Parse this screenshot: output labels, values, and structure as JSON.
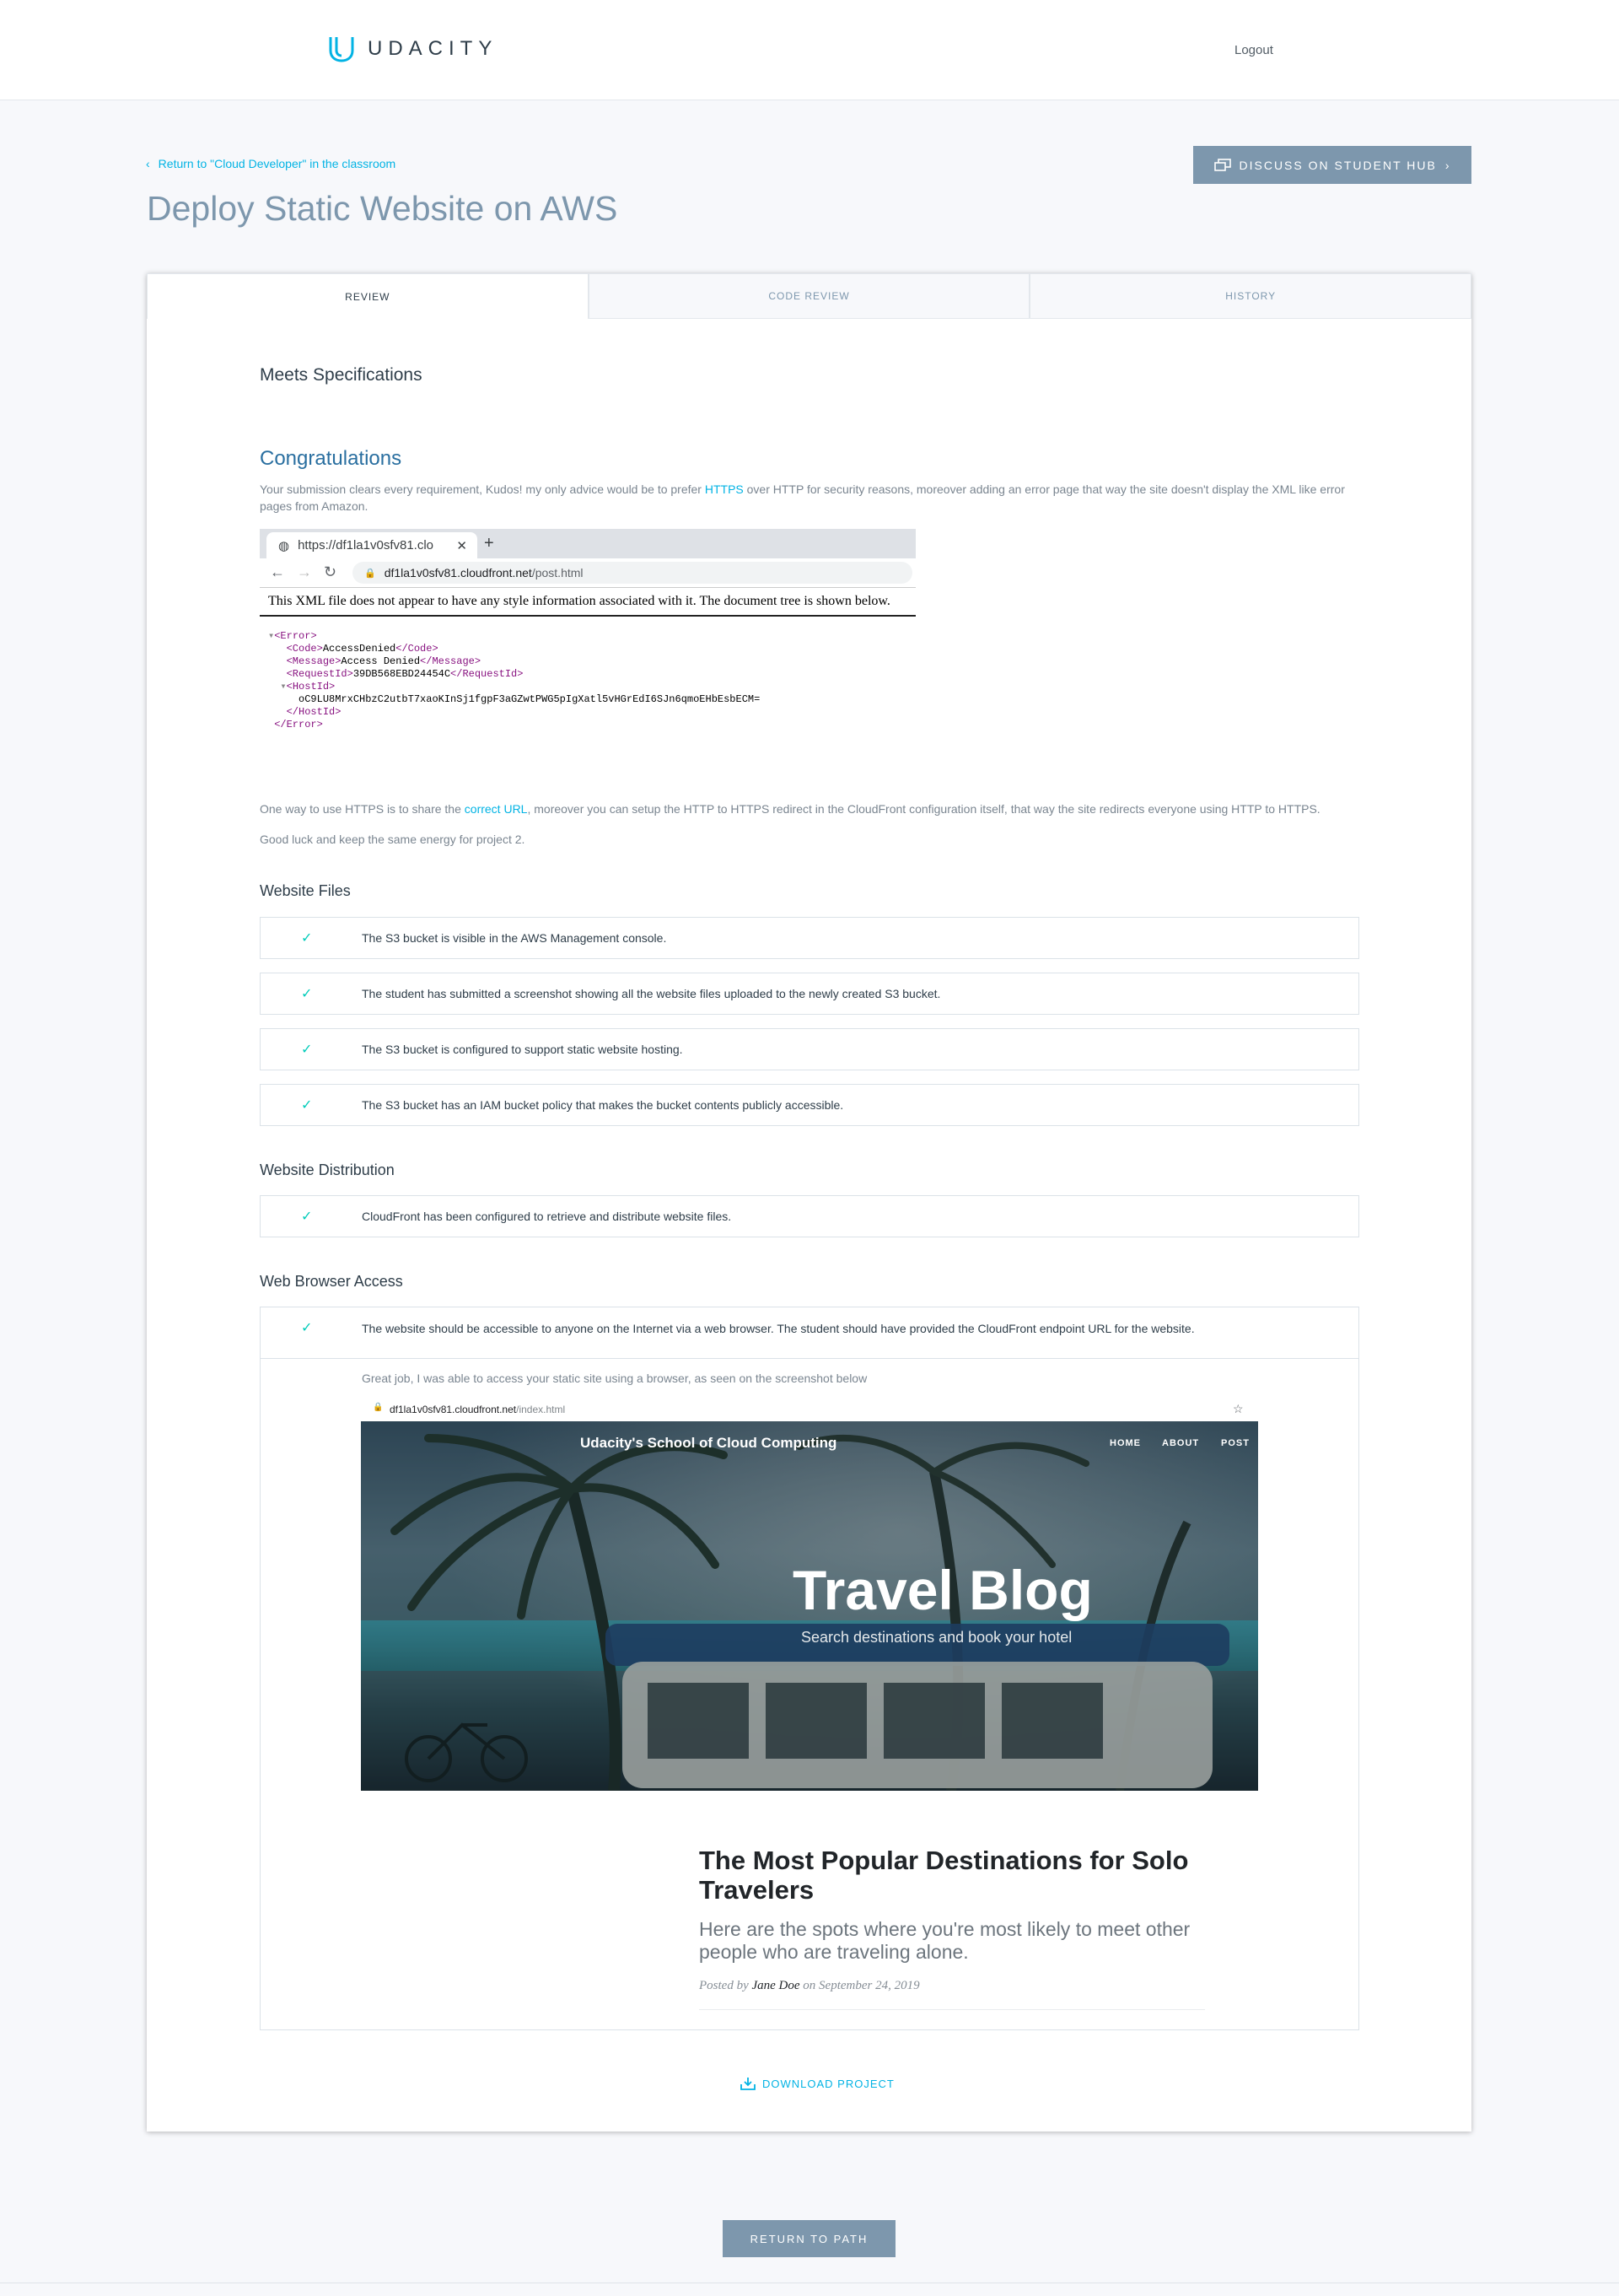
{
  "header": {
    "logo_text": "UDACITY",
    "logout": "Logout"
  },
  "back_link": "Return to \"Cloud Developer\" in the classroom",
  "discuss_button": "DISCUSS ON STUDENT HUB",
  "page_title": "Deploy Static Website on AWS",
  "tabs": [
    {
      "label": "REVIEW"
    },
    {
      "label": "CODE REVIEW"
    },
    {
      "label": "HISTORY"
    }
  ],
  "review": {
    "status": "Meets Specifications",
    "congrats_title": "Congratulations",
    "intro_before": "Your submission clears every requirement, Kudos! my only advice would be to prefer ",
    "intro_link": "HTTPS",
    "intro_after": " over HTTP for security reasons, moreover adding an error page that way the site doesn't display the XML like error pages from Amazon.",
    "screenshot1": {
      "tab_title": "https://df1la1v0sfv81.clo",
      "url_host": "df1la1v0sfv81.cloudfront.net",
      "url_path": "/post.html",
      "xml_message": "This XML file does not appear to have any style information associated with it. The document tree is shown below.",
      "error_code": "AccessDenied",
      "error_message": "Access Denied",
      "request_id": "39DB568EBD24454C",
      "host_id": "oC9LU8MrxCHbzC2utbT7xaoKInSj1fgpF3aGZwtPWG5pIgXatl5vHGrEdI6SJn6qmoEHbEsbECM="
    },
    "https_before": "One way to use HTTPS is to share the ",
    "https_link": "correct URL",
    "https_after": ", moreover you can setup the HTTP to HTTPS redirect in the CloudFront configuration itself, that way the site redirects everyone using HTTP to HTTPS.",
    "good_luck": "Good luck and keep the same energy for project 2."
  },
  "sections": {
    "files": {
      "title": "Website Files",
      "items": [
        "The S3 bucket is visible in the AWS Management console.",
        "The student has submitted a screenshot showing all the website files uploaded to the newly created S3 bucket.",
        "The S3 bucket is configured to support static website hosting.",
        "The S3 bucket has an IAM bucket policy that makes the bucket contents publicly accessible."
      ]
    },
    "distribution": {
      "title": "Website Distribution",
      "items": [
        "CloudFront has been configured to retrieve and distribute website files."
      ]
    },
    "access": {
      "title": "Web Browser Access",
      "items": [
        "The website should be accessible to anyone on the Internet via a web browser. The student should have provided the CloudFront endpoint URL for the website."
      ],
      "comment": "Great job, I was able to access your static site using a browser, as seen on the screenshot below"
    }
  },
  "screenshot2": {
    "url_host": "df1la1v0sfv81.cloudfront.net",
    "url_path": "/index.html",
    "site_title": "Udacity's School of Cloud Computing",
    "nav": [
      "HOME",
      "ABOUT",
      "POST"
    ],
    "hero_title": "Travel Blog",
    "hero_subtitle": "Search destinations and book your hotel",
    "post_title": "The Most Popular Destinations for Solo Travelers",
    "post_subtitle": "Here are the spots where you're most likely to meet other people who are traveling alone.",
    "post_meta_prefix": "Posted by ",
    "post_author": "Jane Doe",
    "post_meta_suffix": " on September 24, 2019"
  },
  "download_label": "DOWNLOAD PROJECT",
  "return_button": "RETURN TO PATH",
  "colors": {
    "accent": "#02b3e4",
    "check": "#02ccba",
    "button": "#7d97ad",
    "title": "#7d97ad"
  },
  "icons": {
    "logo": "udacity-logo-icon",
    "back": "chevron-left-icon",
    "discuss": "chat-icon",
    "check": "check-icon",
    "download": "download-icon"
  }
}
